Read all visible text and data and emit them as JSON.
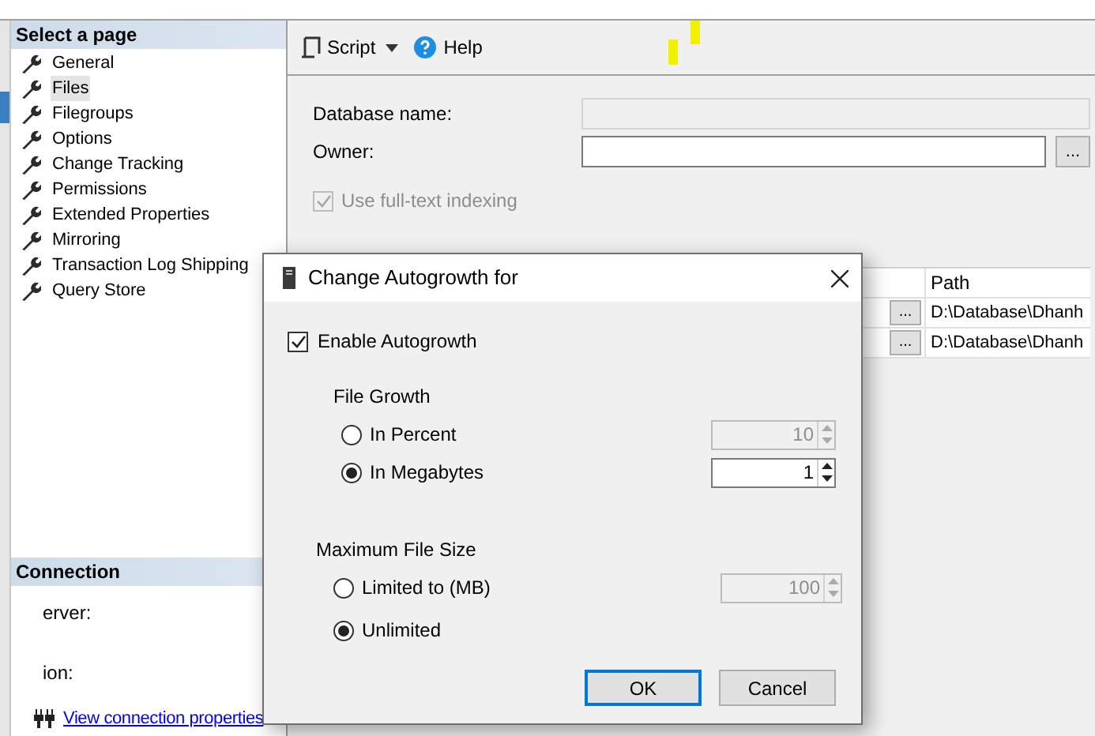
{
  "sidebar": {
    "header": "Select a page",
    "items": [
      {
        "label": "General",
        "selected": false
      },
      {
        "label": "Files",
        "selected": true
      },
      {
        "label": "Filegroups",
        "selected": false
      },
      {
        "label": "Options",
        "selected": false
      },
      {
        "label": "Change Tracking",
        "selected": false
      },
      {
        "label": "Permissions",
        "selected": false
      },
      {
        "label": "Extended Properties",
        "selected": false
      },
      {
        "label": "Mirroring",
        "selected": false
      },
      {
        "label": "Transaction Log Shipping",
        "selected": false
      },
      {
        "label": "Query Store",
        "selected": false
      }
    ]
  },
  "connection": {
    "header": "Connection",
    "fields": [
      "erver:",
      "ion:"
    ],
    "link": "View connection properties"
  },
  "toolbar": {
    "script": "Script",
    "help": "Help"
  },
  "form": {
    "database_name_label": "Database name:",
    "owner_label": "Owner:",
    "owner_browse": "...",
    "fulltext": {
      "label": "Use full-text indexing",
      "checked": true,
      "disabled": true
    }
  },
  "files_grid": {
    "columns": [
      "Path"
    ],
    "rows": [
      {
        "browse": "...",
        "path": "D:\\Database\\Dhanh"
      },
      {
        "browse": "...",
        "path": "D:\\Database\\Dhanh"
      }
    ]
  },
  "dialog": {
    "title": "Change Autogrowth for",
    "enable": {
      "label": "Enable Autogrowth",
      "checked": true
    },
    "file_growth": {
      "label": "File Growth",
      "options": [
        {
          "label": "In Percent",
          "selected": false,
          "value": "10"
        },
        {
          "label": "In Megabytes",
          "selected": true,
          "value": "1"
        }
      ]
    },
    "max_size": {
      "label": "Maximum File Size",
      "options": [
        {
          "label": "Limited to (MB)",
          "selected": false,
          "value": "100"
        },
        {
          "label": "Unlimited",
          "selected": true
        }
      ]
    },
    "buttons": [
      "OK",
      "Cancel"
    ]
  }
}
